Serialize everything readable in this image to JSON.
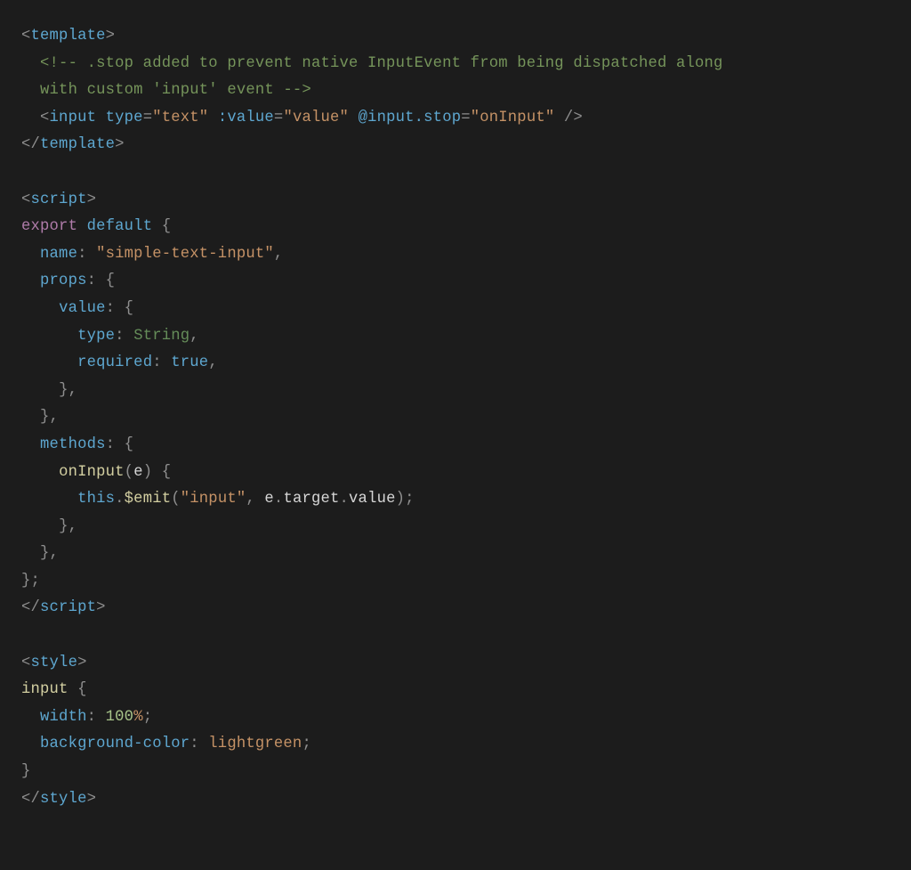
{
  "code": {
    "l1_tag": "template",
    "l2_comment": "<!-- .stop added to prevent native InputEvent from being dispatched along",
    "l3_comment": "with custom 'input' event -->",
    "l4_tag": "input",
    "l4_attr_type": "type",
    "l4_val_type": "\"text\"",
    "l4_attr_value": ":value",
    "l4_val_value": "\"value\"",
    "l4_attr_input": "@input.stop",
    "l4_val_input": "\"onInput\"",
    "l5_tag": "template",
    "l7_tag": "script",
    "l8_export": "export",
    "l8_default": "default",
    "l9_name": "name",
    "l9_name_val": "\"simple-text-input\"",
    "l10_props": "props",
    "l11_value": "value",
    "l12_type": "type",
    "l12_type_val": "String",
    "l13_required": "required",
    "l13_required_val": "true",
    "l16_methods": "methods",
    "l17_fn": "onInput",
    "l17_param": "e",
    "l18_this": "this",
    "l18_emit": "$emit",
    "l18_emit_arg": "\"input\"",
    "l18_e": "e",
    "l18_target": "target",
    "l18_value": "value",
    "l22_tag": "script",
    "l24_tag": "style",
    "l25_selector": "input",
    "l26_prop": "width",
    "l26_num": "100",
    "l26_unit": "%",
    "l27_prop": "background-color",
    "l27_val": "lightgreen",
    "l29_tag": "style"
  }
}
